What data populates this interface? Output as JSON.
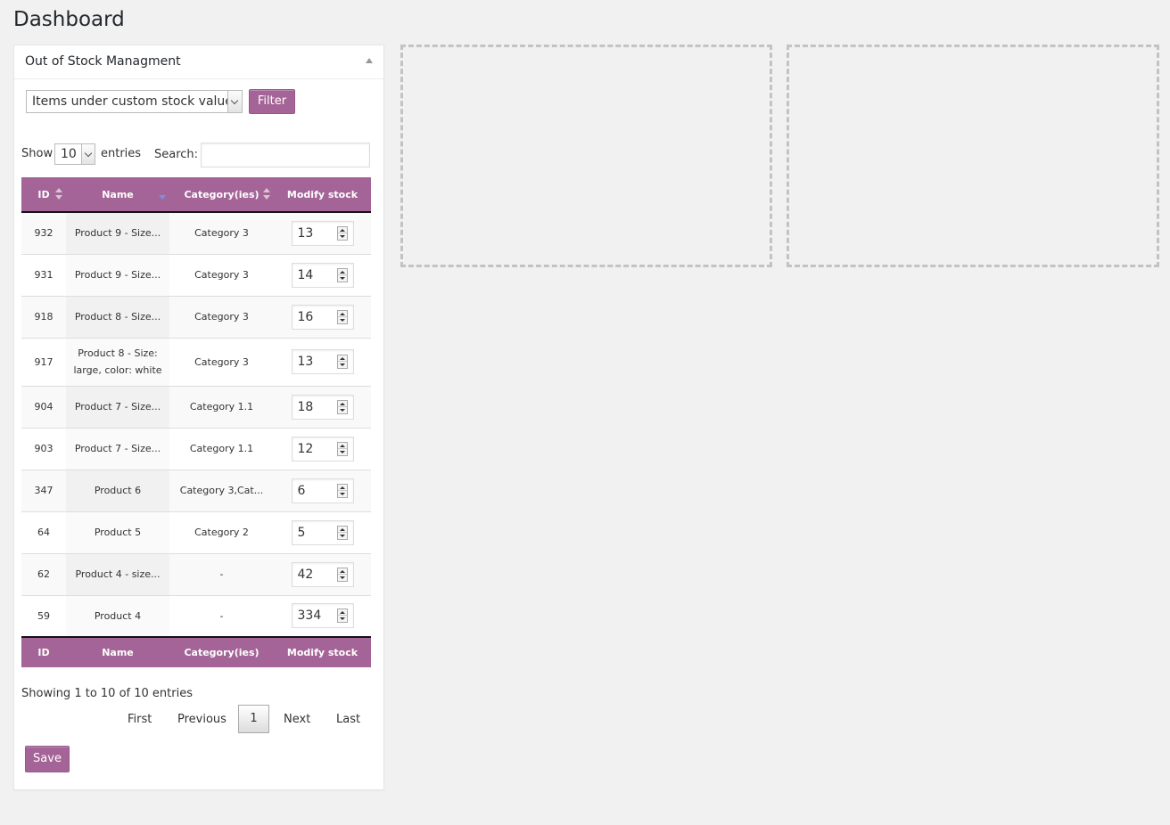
{
  "page": {
    "title": "Dashboard"
  },
  "widget": {
    "title": "Out of Stock Managment",
    "toggle_icon": "triangle-up-icon",
    "filter": {
      "selected": "Items under custom stock values",
      "button_label": "Filter"
    },
    "length": {
      "show_label": "Show",
      "value": "10",
      "entries_label": "entries"
    },
    "search": {
      "label": "Search:",
      "value": ""
    },
    "table": {
      "columns": [
        "ID",
        "Name",
        "Category(ies)",
        "Modify stock"
      ],
      "rows": [
        {
          "id": "932",
          "name": "Product 9 - Size...",
          "category": "Category 3",
          "stock": "13"
        },
        {
          "id": "931",
          "name": "Product 9 - Size...",
          "category": "Category 3",
          "stock": "14"
        },
        {
          "id": "918",
          "name": "Product 8 - Size...",
          "category": "Category 3",
          "stock": "16"
        },
        {
          "id": "917",
          "name": "Product 8 - Size: large, color: white",
          "category": "Category 3",
          "stock": "13"
        },
        {
          "id": "904",
          "name": "Product 7 - Size...",
          "category": "Category 1.1",
          "stock": "18"
        },
        {
          "id": "903",
          "name": "Product 7 - Size...",
          "category": "Category 1.1",
          "stock": "12"
        },
        {
          "id": "347",
          "name": "Product 6",
          "category": "Category 3,Cat...",
          "stock": "6"
        },
        {
          "id": "64",
          "name": "Product 5",
          "category": "Category 2",
          "stock": "5"
        },
        {
          "id": "62",
          "name": "Product 4 - size...",
          "category": "-",
          "stock": "42"
        },
        {
          "id": "59",
          "name": "Product 4",
          "category": "-",
          "stock": "334"
        }
      ]
    },
    "info": "Showing 1 to 10 of 10 entries",
    "pagination": {
      "first": "First",
      "previous": "Previous",
      "current": "1",
      "next": "Next",
      "last": "Last"
    },
    "save_label": "Save"
  },
  "colors": {
    "accent": "#a46497",
    "background": "#f1f1f1"
  }
}
